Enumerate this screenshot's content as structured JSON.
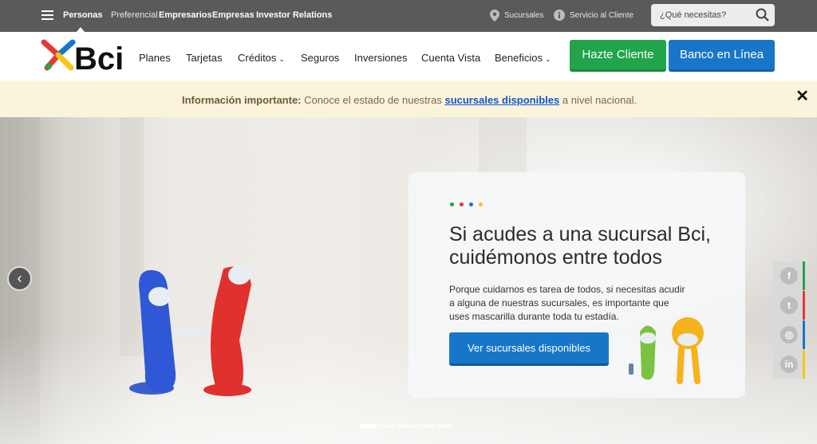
{
  "topbar": {
    "segments": [
      "Personas",
      "Preferencial",
      "Empresarios",
      "Empresas",
      "Investor Relations"
    ],
    "active_segment": "Personas",
    "links": {
      "branches": "Sucursales",
      "service": "Servicio al Cliente"
    },
    "search": {
      "placeholder": "¿Qué necesitas?"
    }
  },
  "header": {
    "logo_text": "Bci",
    "nav": [
      "Planes",
      "Tarjetas",
      "Créditos",
      "Seguros",
      "Inversiones",
      "Cuenta Vista",
      "Beneficios"
    ],
    "cta_primary": "Hazte Cliente",
    "cta_secondary": "Banco en Línea"
  },
  "notice": {
    "label": "Información importante:",
    "text_before": " Conoce el estado de nuestras ",
    "link": "sucursales disponibles",
    "text_after": " a nivel nacional.",
    "close": "✕"
  },
  "hero": {
    "prev_arrow": "‹",
    "title": "Si acudes a una sucursal Bci, cuidémonos entre todos",
    "body": "Porque cuidarnos es tarea de todos, si necesitas acudir a alguna de nuestras sucursales, es importante que uses mascarilla durante toda tu estadía.",
    "button": "Ver sucursales disponibles",
    "dot_colors": [
      "#21a44a",
      "#e53935",
      "#1876c9",
      "#f5c518"
    ],
    "active_slide": 1,
    "slide_count": 5
  },
  "social": [
    {
      "icon": "facebook-icon",
      "glyph": "f",
      "color": "#21a44a"
    },
    {
      "icon": "twitter-icon",
      "glyph": "t",
      "color": "#e53935"
    },
    {
      "icon": "instagram-icon",
      "glyph": "◎",
      "color": "#1876c9"
    },
    {
      "icon": "linkedin-icon",
      "glyph": "in",
      "color": "#f5c518"
    }
  ],
  "brand_colors": {
    "green": "#21a44a",
    "blue": "#1876c9",
    "red": "#e53935",
    "yellow": "#f5c518"
  }
}
